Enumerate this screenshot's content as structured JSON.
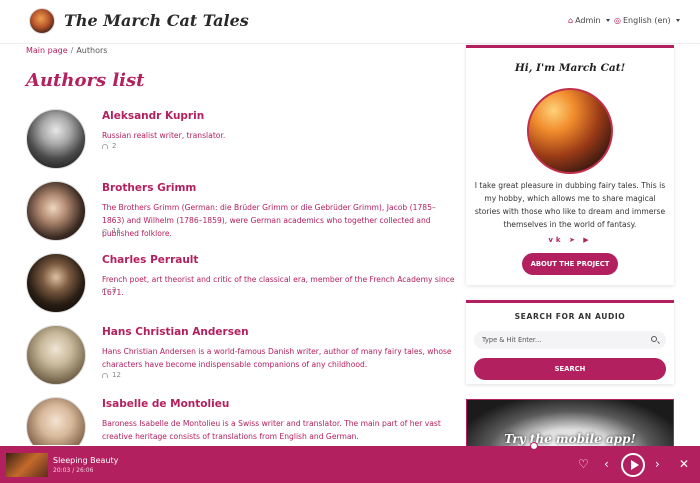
{
  "header": {
    "site_title": "The March Cat Tales",
    "admin_label": "Admin",
    "language_label": "English (en)"
  },
  "breadcrumb": {
    "home": "Main page",
    "separator": "/",
    "current": "Authors"
  },
  "page_title": "Authors list",
  "authors": [
    {
      "name": "Aleksandr Kuprin",
      "description": "Russian realist writer, translator.",
      "count": "2"
    },
    {
      "name": "Brothers Grimm",
      "description": "The Brothers Grimm (German: die Brüder Grimm or die Gebrüder Grimm), Jacob (1785–1863) and Wilhelm (1786–1859), were German academics who together collected and published folklore.",
      "count": "11"
    },
    {
      "name": "Charles Perrault",
      "description": "French poet, art theorist and critic of the classical era, member of the French Academy since 1671.",
      "count": "2"
    },
    {
      "name": "Hans Christian Andersen",
      "description": "Hans Christian Andersen is a world-famous Danish writer, author of many fairy tales, whose characters have become indispensable companions of any childhood.",
      "count": "12"
    },
    {
      "name": "Isabelle de Montolieu",
      "description": "Baroness Isabelle de Montolieu is a Swiss writer and translator. The main part of her vast creative heritage consists of translations from English and German.",
      "count": ""
    }
  ],
  "sidebar": {
    "about": {
      "heading": "Hi, I'm March Cat!",
      "text": "I take great pleasure in dubbing fairy tales. This is my hobby, which allows me to share magical stories with those who like to dream and immerse themselves in the world of fantasy.",
      "button_label": "ABOUT THE PROJECT"
    },
    "search": {
      "heading": "SEARCH FOR AN AUDIO",
      "placeholder": "Type & Hit Enter...",
      "button_label": "SEARCH"
    },
    "app_banner": "Try the mobile app!"
  },
  "player": {
    "track_title": "Sleeping Beauty",
    "track_time": "20:03 / 26:06"
  },
  "colors": {
    "accent": "#b3205f"
  },
  "icons": {
    "admin": "user-icon",
    "language": "globe-icon",
    "listens": "headphones-icon",
    "social": [
      "vk-icon",
      "telegram-icon",
      "youtube-icon"
    ],
    "player": [
      "heart-icon",
      "previous-icon",
      "play-icon",
      "next-icon",
      "close-icon"
    ]
  }
}
